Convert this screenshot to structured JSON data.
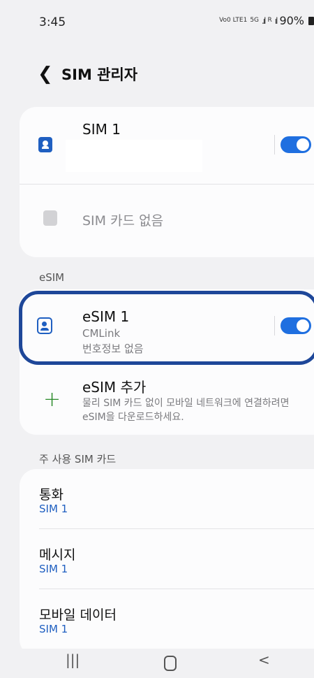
{
  "status_bar": {
    "time": "3:45",
    "network_1": "Vo0 LTE1",
    "network_2": "5G",
    "signal_label": "R",
    "battery": "90%"
  },
  "header": {
    "back_icon": "chevron-left-icon",
    "title": "SIM 관리자"
  },
  "physical_sims": {
    "sim1": {
      "name": "SIM 1",
      "enabled": true
    },
    "sim2": {
      "name": "SIM 카드 없음"
    }
  },
  "esim_section": {
    "title": "eSIM",
    "esim1": {
      "name": "eSIM 1",
      "carrier": "CMLink",
      "number": "번호정보 없음",
      "enabled": true
    },
    "add": {
      "title": "eSIM 추가",
      "description_line1": "물리 SIM 카드 없이 모바일 네트워크에 연결하려면",
      "description_line2": "eSIM을 다운로드하세요."
    }
  },
  "primary_section": {
    "title": "주 사용 SIM 카드",
    "items": [
      {
        "label": "통화",
        "value": "SIM 1"
      },
      {
        "label": "메시지",
        "value": "SIM 1"
      },
      {
        "label": "모바일 데이터",
        "value": "SIM 1"
      }
    ]
  },
  "nav_bar": {
    "recents": "|||",
    "back": "<"
  },
  "colors": {
    "accent": "#1f6fe0",
    "highlight_border": "#1e4799",
    "add_icon": "#2a8a2a",
    "background": "#f1f1f3"
  }
}
